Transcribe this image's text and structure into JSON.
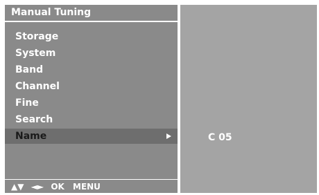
{
  "window": {
    "title": "Manual Tuning"
  },
  "menu": {
    "items": [
      {
        "label": "Storage",
        "selected": false
      },
      {
        "label": "System",
        "selected": false
      },
      {
        "label": "Band",
        "selected": false
      },
      {
        "label": "Channel",
        "selected": false
      },
      {
        "label": "Fine",
        "selected": false
      },
      {
        "label": "Search",
        "selected": false
      },
      {
        "label": "Name",
        "selected": true
      }
    ],
    "submenu_icon": "right-triangle-icon"
  },
  "detail": {
    "value": "C 05"
  },
  "footer": {
    "updown_icon": "▲▼",
    "leftright_icon": "◄►",
    "ok_label": "OK",
    "menu_label": "MENU"
  },
  "colors": {
    "left_panel": "#8a8a8a",
    "right_panel": "#a4a4a4",
    "selected_row": "#6e6e6e",
    "text": "#ffffff",
    "selected_text": "#1a1a1a"
  }
}
